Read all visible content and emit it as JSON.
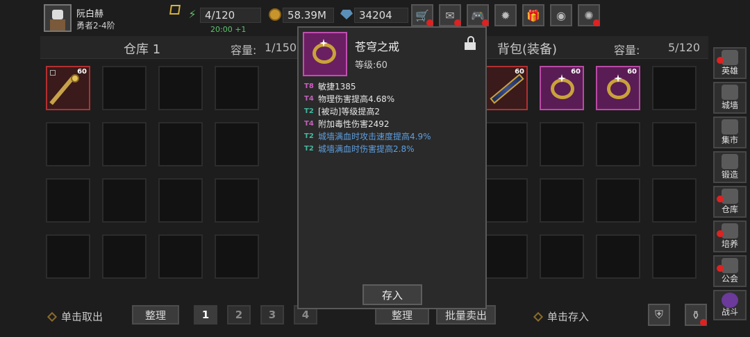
{
  "player": {
    "name": "阮白赫",
    "rank": "勇者2-4阶"
  },
  "resources": {
    "energy": "4/120",
    "energy_regen": "20:00 +1",
    "gold": "58.39M",
    "gems": "34204"
  },
  "top_buttons": [
    "shop-cart-icon",
    "mail-icon",
    "gamepad-icon",
    "settings-gear-icon",
    "gift-icon",
    "color-wheel-icon",
    "firework-icon"
  ],
  "warehouse": {
    "title": "仓库 1",
    "capacity_label": "容量:",
    "capacity_value": "1/150"
  },
  "backpack": {
    "title": "背包(装备)",
    "capacity_label": "容量:",
    "capacity_value": "5/120"
  },
  "warehouse_items": [
    {
      "level": "60",
      "type": "staff",
      "rarity": "red"
    }
  ],
  "backpack_items": [
    {
      "level": "60",
      "type": "sword",
      "rarity": "red"
    },
    {
      "level": "60",
      "type": "ring",
      "rarity": "pink"
    },
    {
      "level": "60",
      "type": "ring",
      "rarity": "pink"
    }
  ],
  "bottom": {
    "take_hint": "单击取出",
    "sort_left": "整理",
    "pages": [
      "1",
      "2",
      "3",
      "4"
    ],
    "sort_right": "整理",
    "bulk_sell": "批量卖出",
    "store_hint": "单击存入"
  },
  "side_nav": [
    {
      "label": "英雄",
      "alert": true
    },
    {
      "label": "城墙",
      "alert": false
    },
    {
      "label": "集市",
      "alert": false
    },
    {
      "label": "锻造",
      "alert": false
    },
    {
      "label": "仓库",
      "alert": true
    },
    {
      "label": "培养",
      "alert": true
    },
    {
      "label": "公会",
      "alert": true
    },
    {
      "label": "战斗",
      "alert": false
    }
  ],
  "popup": {
    "name": "苍穹之戒",
    "level_label": "等级:60",
    "affixes": [
      {
        "tier": "T8",
        "text": "敏捷1385",
        "blue": false
      },
      {
        "tier": "T4",
        "text": "物理伤害提高4.68%",
        "blue": false
      },
      {
        "tier": "T2",
        "text": "[被动]等级提高2",
        "blue": false
      },
      {
        "tier": "T4",
        "text": "附加毒性伤害2492",
        "blue": false
      },
      {
        "tier": "T2",
        "text": "城墙满血时攻击速度提高4.9%",
        "blue": true
      },
      {
        "tier": "T2",
        "text": "城墙满血时伤害提高2.8%",
        "blue": true
      }
    ],
    "store_button": "存入"
  },
  "colors": {
    "background": "#1d1d1d",
    "red_rarity": "#b33030",
    "pink_rarity": "#b94aa6",
    "set_affix_blue": "#5e9fe0",
    "energy_green": "#5fc46c"
  }
}
